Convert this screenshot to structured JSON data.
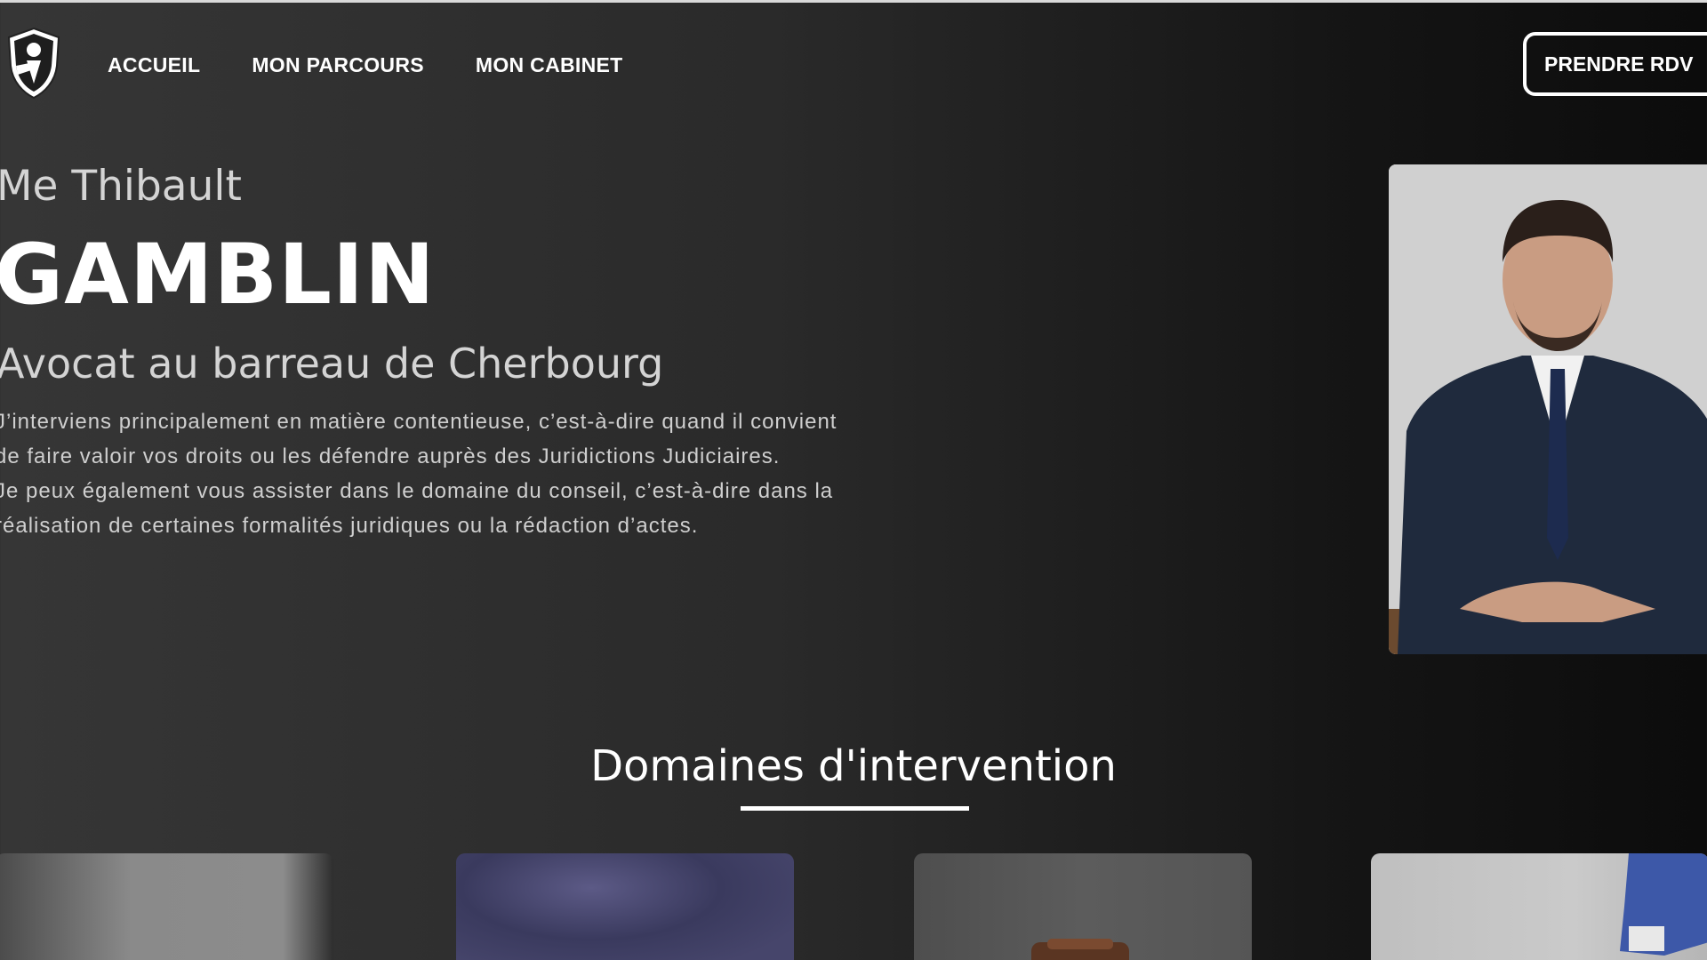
{
  "header": {
    "logo_icon": "shield-scales-logo-icon",
    "nav": {
      "items": [
        {
          "label": "ACCUEIL"
        },
        {
          "label": "MON PARCOURS"
        },
        {
          "label": "MON CABINET"
        }
      ]
    },
    "cta_label": "PRENDRE RDV"
  },
  "hero": {
    "prefix": "Me Thibault",
    "name": "GAMBLIN",
    "subtitle": "Avocat au barreau de Cherbourg",
    "paragraphs": [
      "J’interviens principalement en matière contentieuse, c’est-à-dire quand il convient de faire valoir vos droits ou les défendre auprès des Juridictions Judiciaires.",
      "Je peux également vous assister dans le domaine du conseil, c’est-à-dire dans la réalisation de certaines formalités juridiques ou la rédaction d’actes."
    ],
    "portrait_icon": "lawyer-portrait-photo"
  },
  "domains": {
    "title": "Domaines d'intervention",
    "cards": [
      {
        "image": "domain-photo-1"
      },
      {
        "image": "domain-photo-2"
      },
      {
        "image": "domain-photo-gavel"
      },
      {
        "image": "domain-photo-suit"
      }
    ]
  },
  "colors": {
    "background_light": "#363636",
    "background_dark": "#0c0c0c",
    "text": "#ffffff",
    "text_muted": "#cfcfcf"
  }
}
